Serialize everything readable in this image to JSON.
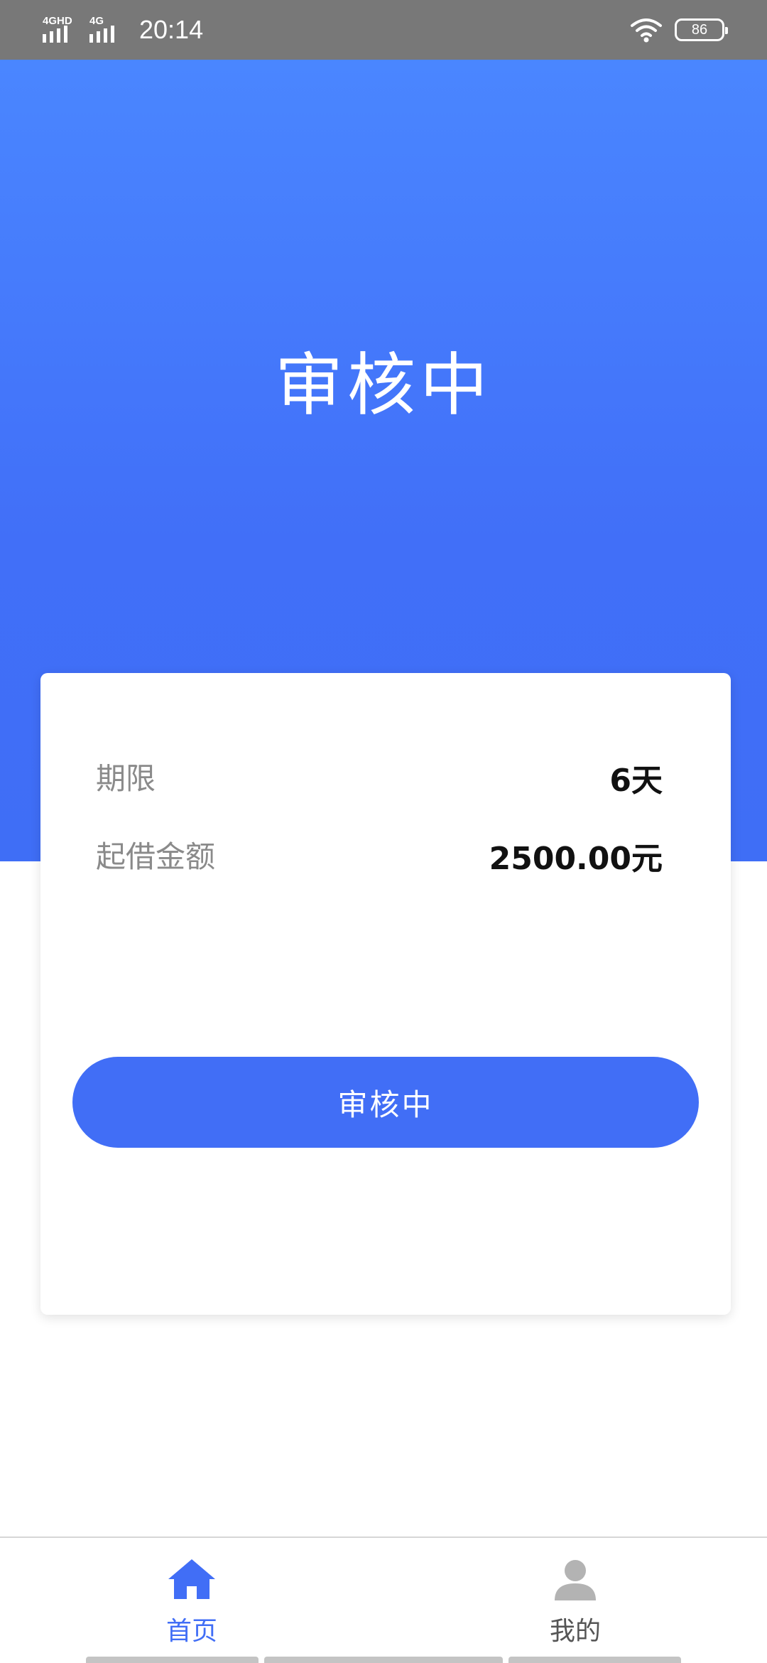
{
  "status_bar": {
    "signal1_label": "4GHD",
    "signal2_label": "4G",
    "time": "20:14",
    "battery": "86",
    "wifi_icon": "wifi-icon",
    "battery_icon": "battery-icon"
  },
  "hero": {
    "title": "审核中"
  },
  "card": {
    "rows": [
      {
        "label": "期限",
        "value": "6天"
      },
      {
        "label": "起借金额",
        "value": "2500.00元"
      }
    ],
    "button_label": "审核中"
  },
  "bottom_nav": {
    "items": [
      {
        "label": "首页",
        "icon": "home-icon",
        "active": true
      },
      {
        "label": "我的",
        "icon": "user-icon",
        "active": false
      }
    ]
  },
  "colors": {
    "accent": "#416ef6",
    "status_bar": "#787878",
    "label_gray": "#8a8a8a"
  }
}
